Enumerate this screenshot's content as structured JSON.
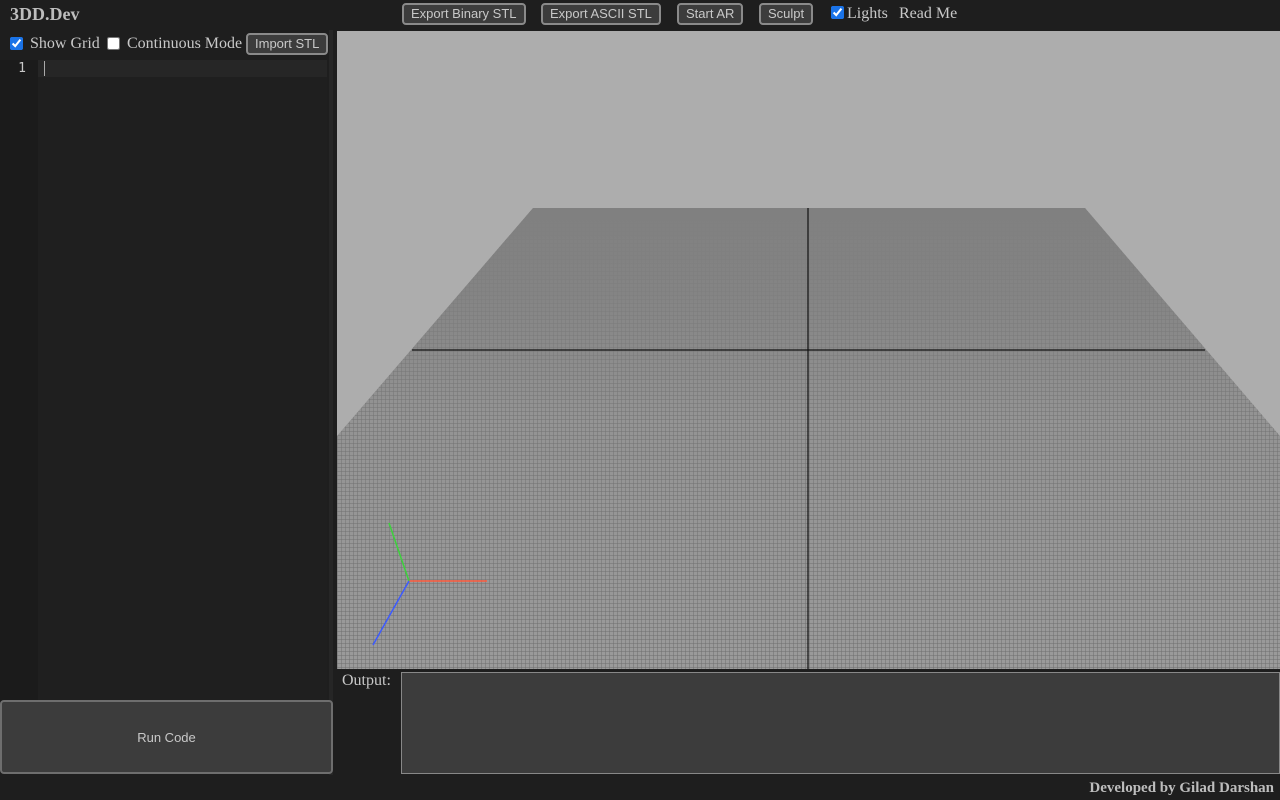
{
  "header": {
    "title": "3DD.Dev",
    "buttons": {
      "export_binary": "Export Binary STL",
      "export_ascii": "Export ASCII STL",
      "start_ar": "Start AR",
      "sculpt": "Sculpt"
    },
    "lights_label": "Lights",
    "lights_checked": true,
    "readme": "Read Me"
  },
  "controls": {
    "show_grid_label": "Show Grid",
    "show_grid_checked": true,
    "continuous_label": "Continuous Mode",
    "continuous_checked": false,
    "import_label": "Import STL"
  },
  "editor": {
    "line_numbers": [
      "1"
    ],
    "content": ""
  },
  "run_button": "Run Code",
  "output": {
    "label": "Output:",
    "text": ""
  },
  "footer": {
    "credit": "Developed by Gilad Darshan"
  },
  "viewport": {
    "background": "#adadad",
    "ground_color": "#808080",
    "axis_colors": {
      "x": "#ff5a3c",
      "y": "#3cd23c",
      "z": "#3c5aff"
    }
  }
}
